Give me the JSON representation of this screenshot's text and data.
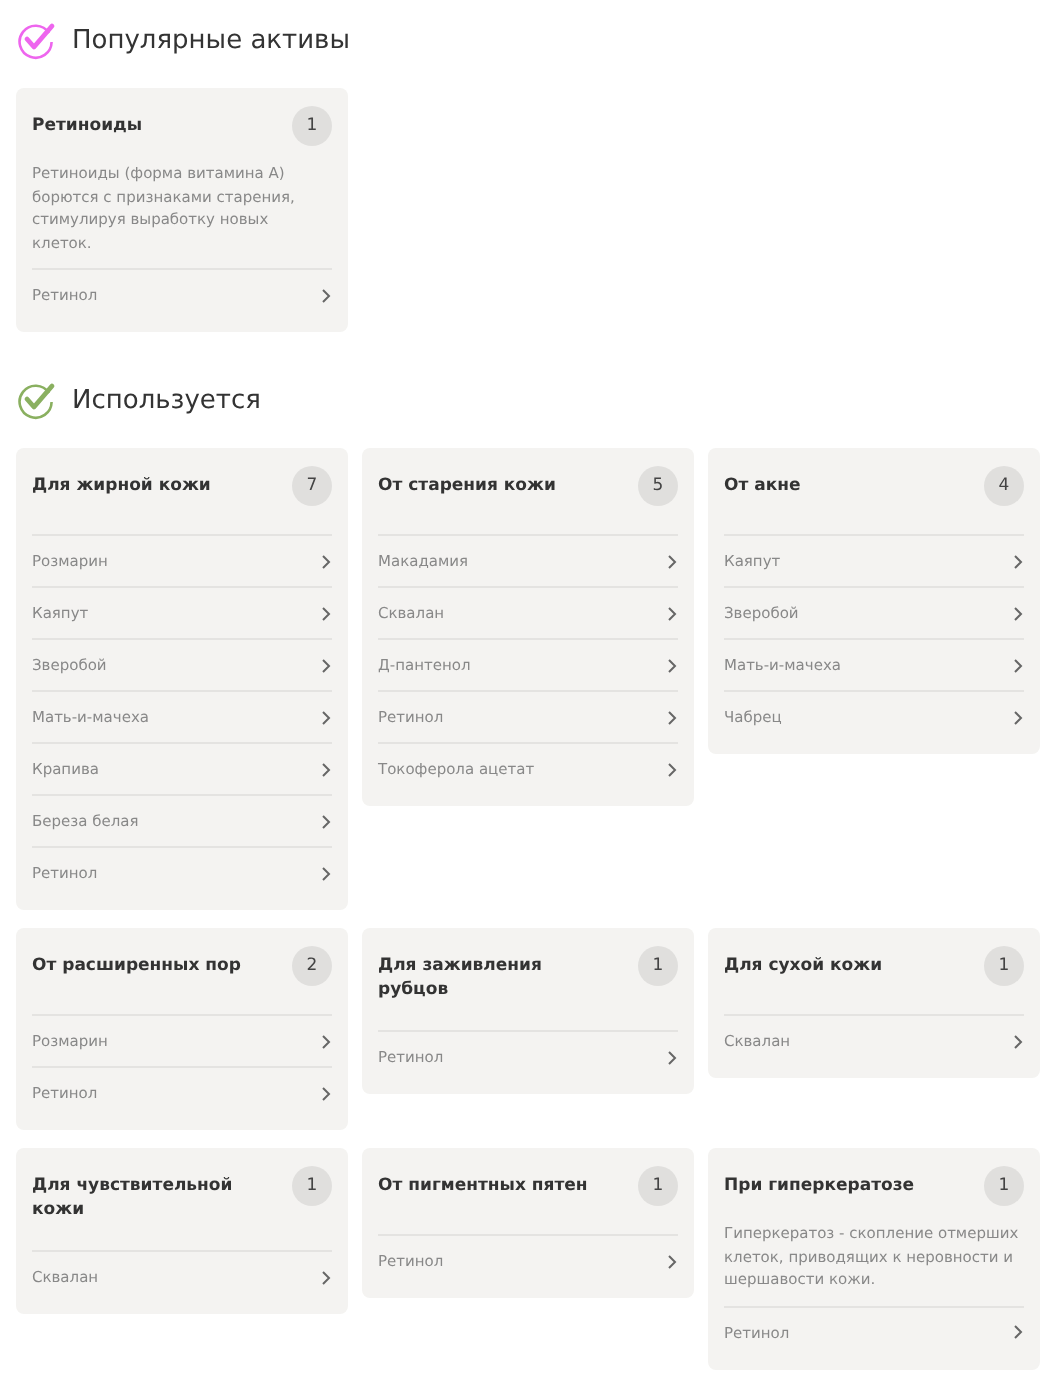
{
  "sections": [
    {
      "title": "Популярные активы",
      "color": "#ee66ee",
      "cards": [
        {
          "title": "Ретиноиды",
          "count": "1",
          "description": "Ретиноиды (форма витамина А) борются с признаками старения, стимулируя выработку новых клеток.",
          "items": [
            "Ретинол"
          ]
        }
      ]
    },
    {
      "title": "Используется",
      "color": "#8ab060",
      "cards": [
        {
          "title": "Для жирной кожи",
          "count": "7",
          "items": [
            "Розмарин",
            "Каяпут",
            "Зверобой",
            "Мать-и-мачеха",
            "Крапива",
            "Береза белая",
            "Ретинол"
          ]
        },
        {
          "title": "От старения кожи",
          "count": "5",
          "items": [
            "Макадамия",
            "Сквалан",
            "Д-пантенол",
            "Ретинол",
            "Токоферола ацетат"
          ]
        },
        {
          "title": "От акне",
          "count": "4",
          "items": [
            "Каяпут",
            "Зверобой",
            "Мать-и-мачеха",
            "Чабрец"
          ]
        },
        {
          "title": "От расширенных пор",
          "count": "2",
          "items": [
            "Розмарин",
            "Ретинол"
          ]
        },
        {
          "title": "Для заживления рубцов",
          "count": "1",
          "items": [
            "Ретинол"
          ]
        },
        {
          "title": "Для сухой кожи",
          "count": "1",
          "items": [
            "Сквалан"
          ]
        },
        {
          "title": "Для чувствительной кожи",
          "count": "1",
          "items": [
            "Сквалан"
          ]
        },
        {
          "title": "От пигментных пятен",
          "count": "1",
          "items": [
            "Ретинол"
          ]
        },
        {
          "title": "При гиперкератозе",
          "count": "1",
          "description": "Гиперкератоз - скопление отмерших клеток, приводящих к неровности и шершавости кожи.",
          "items": [
            "Ретинол"
          ]
        }
      ]
    }
  ]
}
